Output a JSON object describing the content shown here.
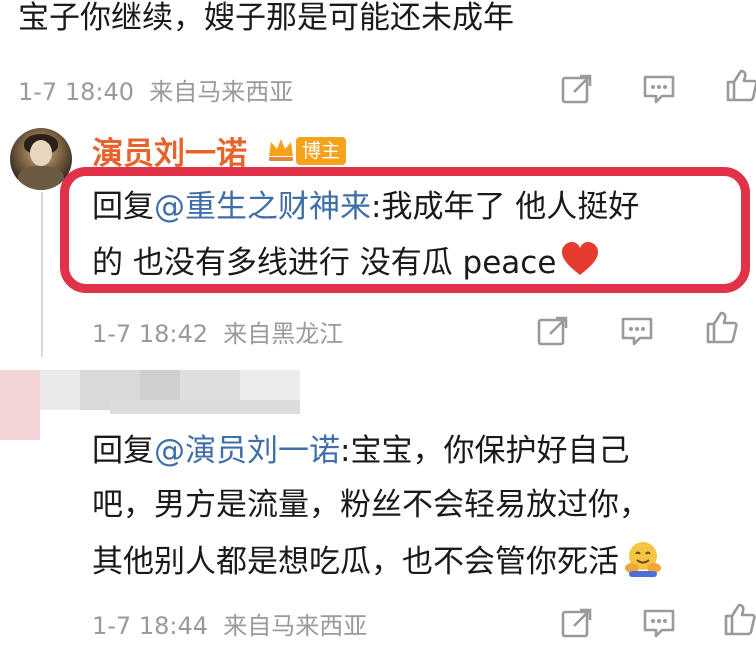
{
  "comments": [
    {
      "text": "宝子你继续，嫂子那是可能还未成年",
      "time": "1-7 18:40",
      "source": "来自马来西亚"
    }
  ],
  "reply_author": {
    "name": "演员刘一诺",
    "badge": "博主",
    "prefix": "回复",
    "mention": "@重生之财神来",
    "line1_rest": ":我成年了 他人挺好",
    "line2": "的 也没有多线进行 没有瓜 peace",
    "emoji": "heart-emoji",
    "time": "1-7 18:42",
    "source": "来自黑龙江"
  },
  "second_reply": {
    "prefix": "回复",
    "mention": "@演员刘一诺",
    "line1_rest": ":宝宝，你保护好自己",
    "line2": "吧，男方是流量，粉丝不会轻易放过你，",
    "line3": "其他别人都是想吃瓜，也不会管你死活",
    "emoji": "hugging-face-emoji",
    "time": "1-7 18:44",
    "source": "来自马来西亚"
  },
  "colors": {
    "highlight_border": "#e0334a",
    "name_color": "#e8632b",
    "link_color": "#3f6ea8",
    "badge_color": "#f6a21c",
    "meta_color": "#9a9a9a"
  },
  "icons": [
    "share-icon",
    "comment-icon",
    "like-icon"
  ]
}
